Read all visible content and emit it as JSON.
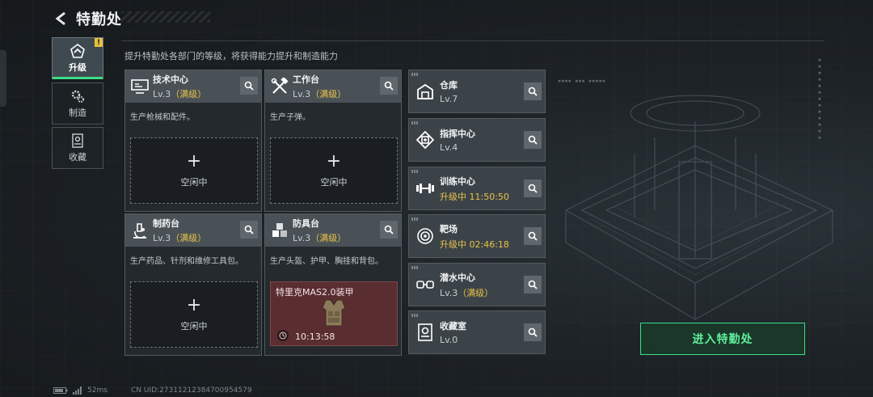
{
  "header": {
    "title": "特勤处"
  },
  "subtitle": "提升特勤处各部门的等级，将获得能力提升和制造能力",
  "side_tabs": [
    {
      "label": "升级",
      "icon": "upgrade-icon",
      "badge": "!"
    },
    {
      "label": "制造",
      "icon": "gears-icon"
    },
    {
      "label": "收藏",
      "icon": "collection-icon"
    }
  ],
  "cards": [
    {
      "name": "技术中心",
      "level": "Lv.3",
      "max": "（满级）",
      "desc": "生产枪械和配件。",
      "slot": {
        "plus": "+",
        "state": "空闲中"
      },
      "icon": "monitor-icon"
    },
    {
      "name": "工作台",
      "level": "Lv.3",
      "max": "（满级）",
      "desc": "生产子弹。",
      "slot": {
        "plus": "+",
        "state": "空闲中"
      },
      "icon": "tools-icon"
    },
    {
      "name": "制药台",
      "level": "Lv.3",
      "max": "（满级）",
      "desc": "生产药品、针剂和维修工具包。",
      "slot": {
        "plus": "+",
        "state": "空闲中"
      },
      "icon": "microscope-icon"
    },
    {
      "name": "防具台",
      "level": "Lv.3",
      "max": "（满级）",
      "desc": "生产头盔、护甲、胸挂和背包。",
      "craft": {
        "item": "特里克MAS2.0装甲",
        "time": "10:13:58"
      },
      "icon": "armor-icon"
    }
  ],
  "small_cards": [
    {
      "name": "仓库",
      "status": "Lv.7",
      "icon": "warehouse-icon"
    },
    {
      "name": "指挥中心",
      "status": "Lv.4",
      "icon": "command-icon"
    },
    {
      "name": "训练中心",
      "status": "升级中 11:50:50",
      "upgrading": true,
      "icon": "dumbbell-icon"
    },
    {
      "name": "靶场",
      "status": "升级中 02:46:18",
      "upgrading": true,
      "icon": "target-icon"
    },
    {
      "name": "潜水中心",
      "level": "Lv.3",
      "max": "（满级）",
      "icon": "goggles-icon"
    },
    {
      "name": "收藏室",
      "status": "Lv.0",
      "icon": "vault-icon"
    }
  ],
  "enter_button": "进入特勤处",
  "status_bar": {
    "ping": "52ms",
    "uid": "CN UID:27311212384700954579"
  },
  "colors": {
    "accent": "#3ddc84",
    "max_level": "#e8c24a",
    "badge": "#e5c23e"
  }
}
